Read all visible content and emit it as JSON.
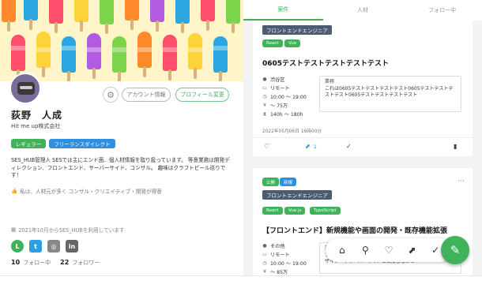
{
  "profile": {
    "name": "荻野　人成",
    "company": "Hit me up株式会社",
    "account_button": "アカウント情報",
    "edit_button": "プロフィール変更",
    "tags": [
      "レギュラー",
      "フリーランスダイレクト"
    ],
    "bio": "SES_HUB管理人 SESでは主にエンド面、個人材情報を取り扱っています。 等意業務は開発ディレクション、フロントエンド、サーバーサイド、コンサル。 趣味はクラフトビール巡りです！",
    "interest": "私は、人材元が多く コンサル・クリエイティブ・開発が得意",
    "since": "2021年10月からSES_HUBを利用しています",
    "following_count": "10",
    "following_label": "フォロー中",
    "followers_count": "22",
    "followers_label": "フォロワー"
  },
  "tabs": [
    "案件",
    "人材",
    "フォロー中"
  ],
  "posts": [
    {
      "category": "フロントエンドエンジニア",
      "skills": [
        "React",
        "Vue"
      ],
      "title": "0605テストテストテストテストテスト",
      "location": "渋谷区",
      "work_style": "リモート",
      "hours": "10:00 〜 19:00",
      "price": "〜 75万",
      "time_range": "140h 〜 180h",
      "desc_label": "業務",
      "description": "これは0605テストテストテストテスト0605テストテストテストテスト0605テストテストテストテスト",
      "posted": "2022年05月06日 16時00分",
      "share_count": "1"
    },
    {
      "badges": [
        "公開",
        "新規"
      ],
      "category": "フロントエンドエンジニア",
      "skills": [
        "React",
        "Vue.js",
        "TypeScript"
      ],
      "title": "【フロントエンド】新規機能や画面の開発・既存機能拡張",
      "location": "その他",
      "work_style": "リモート",
      "hours": "10:00 〜 19:00",
      "price": "〜 85万",
      "desc_label": "業務",
      "description": "フロントエンド開発のアーキテクチャ設計から実装まで、デザイナーやサーバーサイドと密接しながら"
    }
  ],
  "colors": {
    "accent": "#3fb25a",
    "blue": "#2f8fe0",
    "category": "#4c5a72"
  }
}
